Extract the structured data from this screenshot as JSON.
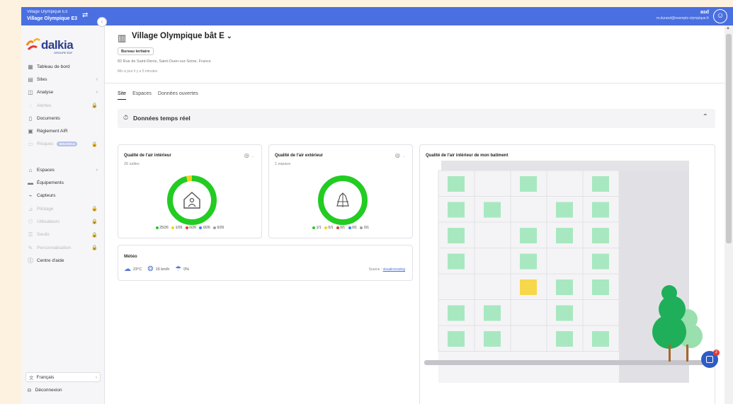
{
  "topbar": {
    "site_line1": "Village Olympique E3",
    "site_line2": "Village Olympique E3",
    "user_name": "asd",
    "user_email": "m.durand@exemple-olympique.fr"
  },
  "sidebar": {
    "logo_word": "dalkia",
    "logo_sub": "GROUPE EDF",
    "items": [
      {
        "label": "Tableau de bord",
        "trail": ""
      },
      {
        "label": "Sites",
        "trail": "›"
      },
      {
        "label": "Analyse",
        "trail": "›"
      },
      {
        "label": "Alertes",
        "trail": "🔒"
      },
      {
        "label": "Documents",
        "trail": ""
      },
      {
        "label": "Règlement AIR",
        "trail": ""
      },
      {
        "label": "Risques",
        "trail": "🔒",
        "badge": "NOUVEAU"
      },
      {
        "label": "Espaces",
        "trail": "›"
      },
      {
        "label": "Équipements",
        "trail": ""
      },
      {
        "label": "Capteurs",
        "trail": ""
      },
      {
        "label": "Pilotage",
        "trail": "🔒"
      },
      {
        "label": "Utilisateurs",
        "trail": "🔒"
      },
      {
        "label": "Seuils",
        "trail": "🔒"
      },
      {
        "label": "Personnalisation",
        "trail": "🔒"
      },
      {
        "label": "Centre d'aide",
        "trail": ""
      }
    ],
    "language": "Français",
    "logout": "Déconnexion"
  },
  "header": {
    "title": "Village Olympique bât E",
    "chip": "Bureau tertiaire",
    "address": "82 Rue de Saint-Denis, Saint-Ouen-sur-Seine, France",
    "updated": "Mis à jour il y a 5 minutes"
  },
  "tabs": [
    "Site",
    "Espaces",
    "Données ouvertes"
  ],
  "realtime": {
    "label": "Données temps réel"
  },
  "indoor": {
    "title": "Qualité de l'air intérieur",
    "subtitle": "26 salles",
    "counts": {
      "green": 25,
      "yellow": 1,
      "red": 0,
      "blue": 0,
      "grey": 0
    },
    "total": 26,
    "legend": [
      "25/26",
      "1/26",
      "0/26",
      "0/26",
      "0/26"
    ]
  },
  "outdoor": {
    "title": "Qualité de l'air extérieur",
    "subtitle": "1 espace",
    "counts": {
      "green": 1,
      "yellow": 0,
      "red": 0,
      "blue": 0,
      "grey": 0
    },
    "total": 1,
    "legend": [
      "1/1",
      "0/1",
      "0/1",
      "0/1",
      "0/1"
    ]
  },
  "meteo": {
    "title": "Météo",
    "temp": "23°C",
    "wind": "15 km/h",
    "rain": "0%",
    "source_label": "Source : ",
    "source_link": "visualcrossing"
  },
  "building": {
    "title": "Qualité de l'air intérieur de mon batiment",
    "rows": [
      [
        "g",
        "",
        "g",
        "",
        "g"
      ],
      [
        "g",
        "g",
        "",
        "g",
        "g"
      ],
      [
        "g",
        "",
        "g",
        "g",
        "g"
      ],
      [
        "g",
        "",
        "g",
        "",
        "g"
      ],
      [
        "",
        "",
        "y",
        "g",
        "g"
      ],
      [
        "g",
        "g",
        "",
        "g",
        ""
      ],
      [
        "g",
        "g",
        "",
        "g",
        "g"
      ]
    ]
  },
  "colors": {
    "accent": "#4a6fe0",
    "good": "#22cc22",
    "medium": "#f5d020",
    "bad": "#e53935",
    "info": "#3b82f6",
    "none": "#9e9e9e",
    "window_good": "#a8e8c0",
    "window_medium": "#f6d84a"
  },
  "chat": {
    "notifications": "2"
  }
}
